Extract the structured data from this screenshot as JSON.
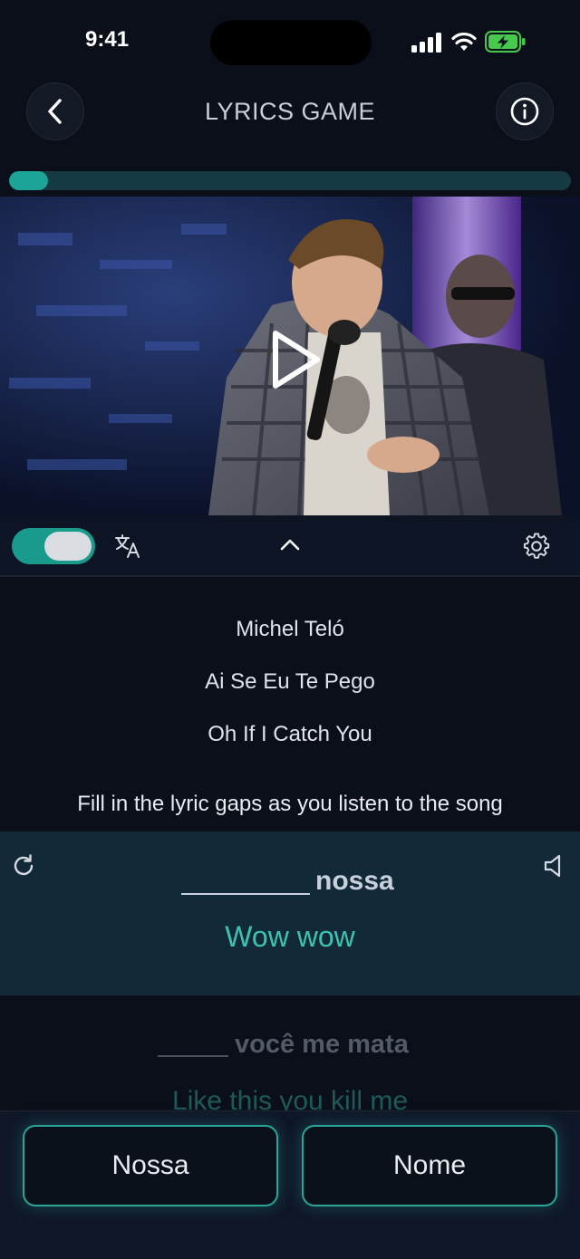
{
  "status": {
    "time": "9:41"
  },
  "header": {
    "title": "LYRICS GAME"
  },
  "progress": {
    "fraction": 0.07
  },
  "video": {
    "state": "paused"
  },
  "controls": {
    "translation_toggle_on": true
  },
  "song": {
    "artist": "Michel Teló",
    "title": "Ai Se Eu Te Pego",
    "title_translated": "Oh If I Catch You"
  },
  "instructions": "Fill in the lyric gaps as you listen to the song",
  "current_line": {
    "word": "nossa",
    "translation": "Wow wow"
  },
  "next_line": {
    "word": "você me mata",
    "translation": "Like this you kill me"
  },
  "answers": [
    "Nossa",
    "Nome"
  ],
  "colors": {
    "accent": "#1aa597",
    "background": "#0b0f1a",
    "active_line": "#122a37",
    "translation": "#3fc2b4"
  }
}
